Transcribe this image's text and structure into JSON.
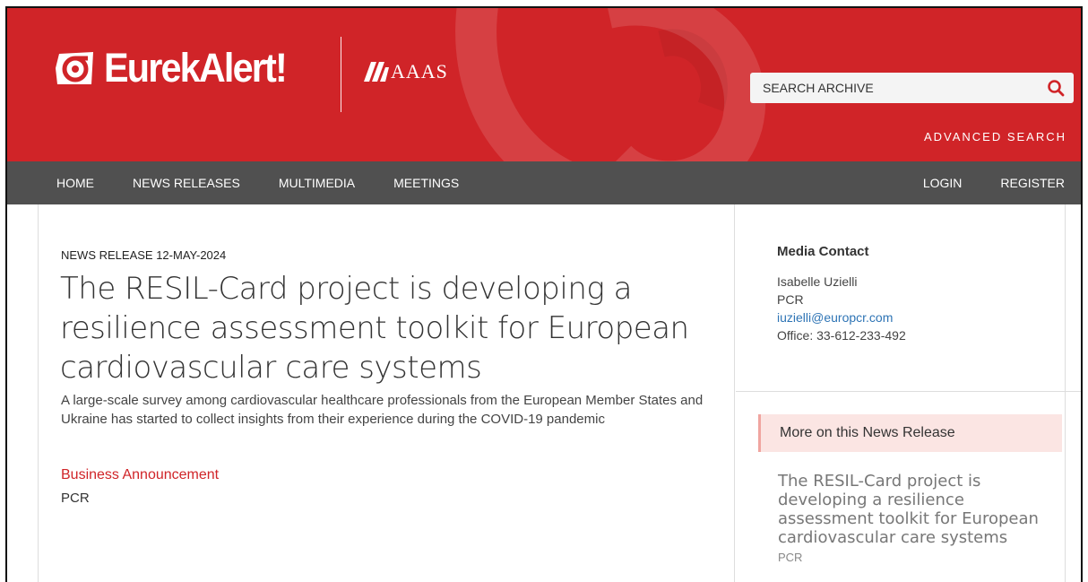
{
  "header": {
    "logo_text": "EurekAlert!",
    "partner_text": "AAAS",
    "search_placeholder": "SEARCH ARCHIVE",
    "advanced_search": "ADVANCED SEARCH",
    "brand_color": "#d02428"
  },
  "nav": {
    "left": [
      "HOME",
      "NEWS RELEASES",
      "MULTIMEDIA",
      "MEETINGS"
    ],
    "right": [
      "LOGIN",
      "REGISTER"
    ]
  },
  "article": {
    "eyebrow": "NEWS RELEASE 12-MAY-2024",
    "headline": "The RESIL-Card project is developing a resilience assessment toolkit for European cardiovascular care systems",
    "subhead": "A large-scale survey among cardiovascular healthcare professionals from the European Member States and Ukraine has started to collect insights from their experience during the COVID-19 pandemic",
    "category": "Business Announcement",
    "organization": "PCR"
  },
  "sidebar": {
    "contact_title": "Media Contact",
    "contact_name": "Isabelle Uzielli",
    "contact_org": "PCR",
    "contact_email": "iuzielli@europcr.com",
    "contact_phone": "Office: 33-612-233-492",
    "more_heading": "More on this News Release",
    "more_item_title": "The RESIL-Card project is developing a resilience assessment toolkit for European cardiovascular care systems",
    "more_item_org": "PCR"
  }
}
